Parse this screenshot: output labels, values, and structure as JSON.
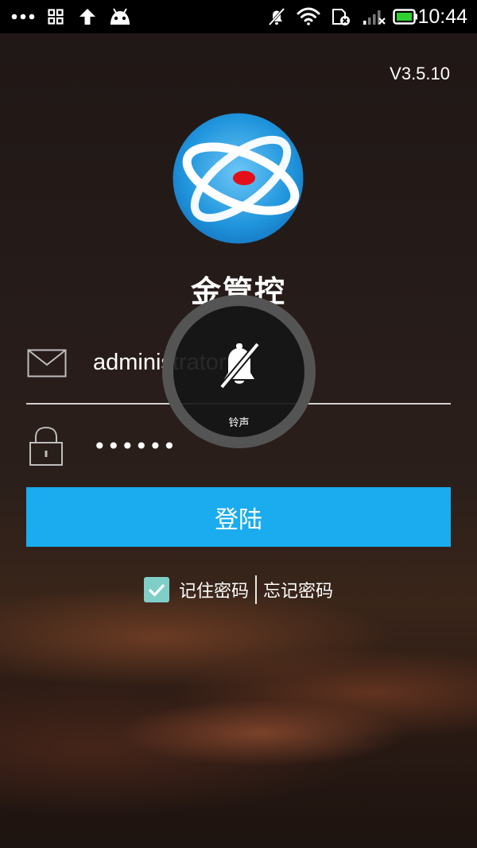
{
  "status_bar": {
    "time": "10:44",
    "icons": [
      "more-dots-icon",
      "apps-grid-icon",
      "upload-arrow-icon",
      "android-icon",
      "bell-muted-icon",
      "wifi-icon",
      "sim-off-icon",
      "signal-weak-icon",
      "battery-icon"
    ]
  },
  "app": {
    "version": "V3.5.10",
    "title": "金管控"
  },
  "login_form": {
    "username": "administrator",
    "password_masked": "••••••",
    "login_label": "登陆",
    "remember_label": "记住密码",
    "remember_checked": true,
    "forgot_label": "忘记密码"
  },
  "ringer_toast": {
    "label": "铃声",
    "icon": "bell-muted-icon"
  },
  "colors": {
    "accent": "#1aacee",
    "checkbox": "#7fcfc8",
    "logo_blue": "#2a9be0",
    "logo_red": "#e3101a"
  }
}
